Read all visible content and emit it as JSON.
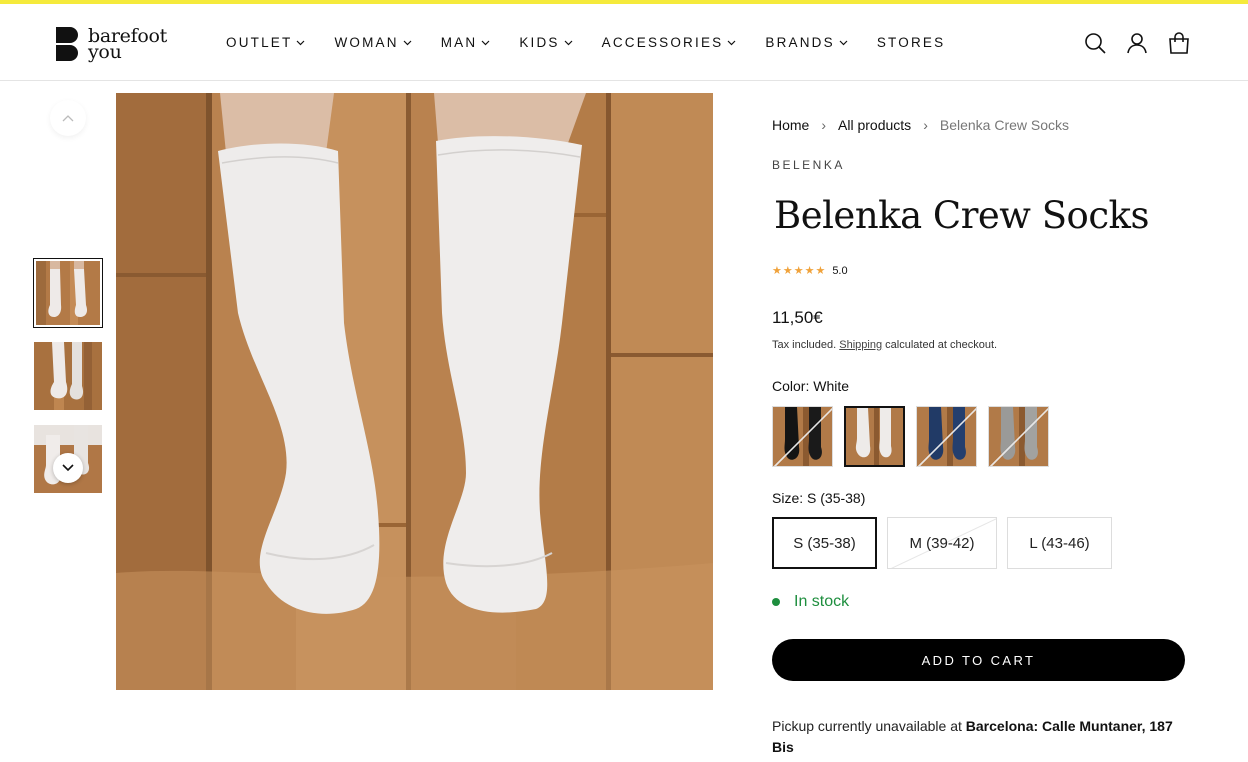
{
  "header": {
    "logo_line1": "barefoot",
    "logo_line2": "you",
    "nav": [
      {
        "label": "OUTLET",
        "has_dropdown": true
      },
      {
        "label": "WOMAN",
        "has_dropdown": true
      },
      {
        "label": "MAN",
        "has_dropdown": true
      },
      {
        "label": "KIDS",
        "has_dropdown": true
      },
      {
        "label": "ACCESSORIES",
        "has_dropdown": true
      },
      {
        "label": "BRANDS",
        "has_dropdown": true
      },
      {
        "label": "STORES",
        "has_dropdown": false
      }
    ],
    "icons": [
      "search-icon",
      "account-icon",
      "cart-icon"
    ]
  },
  "gallery": {
    "thumbnails": [
      "front view",
      "side view",
      "walking view"
    ],
    "active_index": 0
  },
  "product": {
    "breadcrumb": [
      "Home",
      "All products",
      "Belenka Crew Socks"
    ],
    "vendor": "BELENKA",
    "title": "Belenka Crew Socks",
    "stars": "★★★★★",
    "rating": "5.0",
    "price": "11,50€",
    "tax_prefix": "Tax included.",
    "tax_link": "Shipping",
    "tax_suffix": "calculated at checkout.",
    "color_label": "Color:",
    "color_value": "White",
    "colors": [
      {
        "name": "Black",
        "available": false
      },
      {
        "name": "White",
        "available": true,
        "selected": true
      },
      {
        "name": "Navy",
        "available": false
      },
      {
        "name": "Grey",
        "available": false
      }
    ],
    "size_label": "Size:",
    "size_value": "S (35-38)",
    "sizes": [
      {
        "label": "S (35-38)",
        "selected": true,
        "available": true
      },
      {
        "label": "M (39-42)",
        "selected": false,
        "available": false
      },
      {
        "label": "L (43-46)",
        "selected": false,
        "available": true
      }
    ],
    "stock": "In stock",
    "add_to_cart": "ADD TO CART",
    "pickup_prefix": "Pickup currently unavailable at",
    "pickup_location": "Barcelona: Calle Muntaner, 187 Bis"
  },
  "colors": {
    "accent_bar": "#f5ea3b",
    "star": "#f0a23a",
    "in_stock": "#1e8e3e"
  }
}
